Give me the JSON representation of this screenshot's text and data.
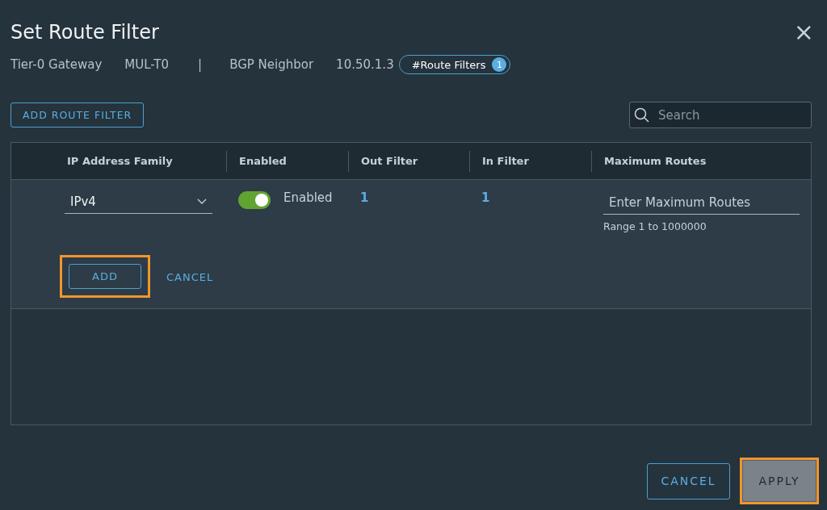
{
  "dialog": {
    "title": "Set Route Filter",
    "close_label": "×"
  },
  "context": [
    {
      "kind": "text",
      "text": "Tier-0 Gateway"
    },
    {
      "kind": "text",
      "text": "MUL-T0"
    },
    {
      "kind": "separator",
      "text": "|"
    },
    {
      "kind": "text",
      "text": "BGP Neighbor"
    },
    {
      "kind": "text",
      "text": "10.50.1.3"
    },
    {
      "kind": "pill",
      "text": "#Route Filters",
      "count": "1"
    }
  ],
  "toolbar": {
    "add_button": "ADD ROUTE FILTER",
    "search": {
      "placeholder": "Search"
    }
  },
  "table": {
    "columns": [
      "IP Address Family",
      "Enabled",
      "Out Filter",
      "In Filter",
      "Maximum Routes"
    ],
    "edit_row": {
      "ip_family": "IPv4",
      "enabled": {
        "on": true,
        "label": "Enabled"
      },
      "out_filter": "1",
      "in_filter": "1",
      "max_routes": {
        "placeholder": "Enter Maximum Routes",
        "hint": "Range 1 to 1000000"
      },
      "actions": [
        {
          "kind": "outline",
          "label": "ADD",
          "highlighted": true
        },
        {
          "kind": "flat",
          "label": "CANCEL",
          "highlighted": false
        }
      ]
    }
  },
  "footer": [
    {
      "kind": "outline",
      "label": "CANCEL",
      "disabled": false,
      "highlighted": false
    },
    {
      "kind": "solid",
      "label": "APPLY",
      "disabled": true,
      "highlighted": true
    }
  ]
}
